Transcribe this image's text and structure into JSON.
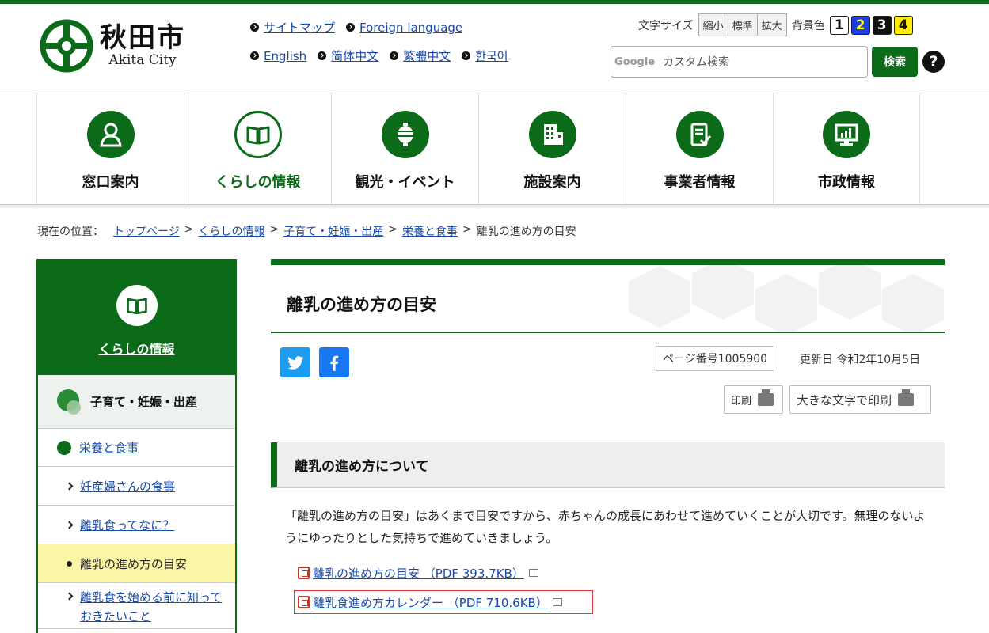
{
  "header": {
    "logo_jp": "秋田市",
    "logo_en": "Akita City",
    "links_row1": [
      "サイトマップ",
      "Foreign language"
    ],
    "links_row2": [
      "English",
      "简体中文",
      "繁體中文",
      "한국어"
    ],
    "font_size_label": "文字サイズ",
    "font_size_options": [
      "縮小",
      "標準",
      "拡大"
    ],
    "bg_color_label": "背景色",
    "bg_options": [
      "1",
      "2",
      "3",
      "4"
    ],
    "search_provider": "Google",
    "search_placeholder": "カスタム検索",
    "search_button": "検索",
    "help": "?"
  },
  "gnav": [
    {
      "label": "窓口案内",
      "icon": "person-icon"
    },
    {
      "label": "くらしの情報",
      "icon": "book-icon",
      "active": true
    },
    {
      "label": "観光・イベント",
      "icon": "lantern-icon"
    },
    {
      "label": "施設案内",
      "icon": "building-icon"
    },
    {
      "label": "事業者情報",
      "icon": "document-check-icon"
    },
    {
      "label": "市政情報",
      "icon": "chart-monitor-icon"
    }
  ],
  "breadcrumb": {
    "prefix": "現在の位置：",
    "items": [
      "トップページ",
      "くらしの情報",
      "子育て・妊娠・出産",
      "栄養と食事"
    ],
    "current": "離乳の進め方の目安",
    "separator": ">"
  },
  "sidebar": {
    "title": "くらしの情報",
    "section": "子育て・妊娠・出産",
    "category": "栄養と食事",
    "items": [
      "妊産婦さんの食事",
      "離乳食ってなに？",
      "離乳の進め方の目安",
      "離乳食を始める前に知っておきたいこと"
    ]
  },
  "main": {
    "title": "離乳の進め方の目安",
    "page_no": "ページ番号1005900",
    "updated": "更新日 令和2年10月5日",
    "print": "印刷",
    "print_large": "大きな文字で印刷",
    "heading": "離乳の進め方について",
    "body": "「離乳の進め方の目安」はあくまで目安ですから、赤ちゃんの成長にあわせて進めていくことが大切です。無理のないようにゆったりとした気持ちで進めていきましょう。",
    "files": [
      "離乳の進め方の目安 （PDF 393.7KB）",
      "離乳食進め方カレンダー （PDF 710.6KB）"
    ]
  },
  "colors": {
    "brand_green": "#0b6b18",
    "highlight_yellow": "#fbf6a6",
    "link_blue": "#1a4aa5",
    "twitter": "#1d9bf0",
    "facebook": "#1877f2"
  }
}
